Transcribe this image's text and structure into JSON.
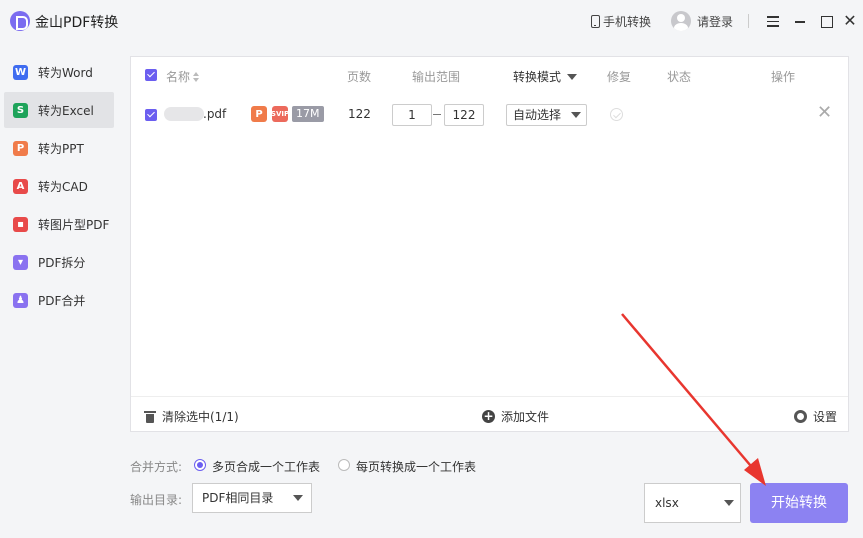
{
  "app": {
    "title": "金山PDF转换"
  },
  "titlebar": {
    "mobile_label": "手机转换",
    "login_label": "请登录"
  },
  "sidebar": {
    "items": [
      {
        "label": "转为Word",
        "icon": "W",
        "color": "#3f6cf0",
        "active": false
      },
      {
        "label": "转为Excel",
        "icon": "S",
        "color": "#1ea35a",
        "active": true
      },
      {
        "label": "转为PPT",
        "icon": "P",
        "color": "#f07b4a",
        "active": false
      },
      {
        "label": "转为CAD",
        "icon": "A",
        "color": "#e84a4a",
        "active": false
      },
      {
        "label": "转图片型PDF",
        "icon": "▪",
        "color": "#e84a4a",
        "active": false
      },
      {
        "label": "PDF拆分",
        "icon": "▾",
        "color": "#8a72f0",
        "active": false
      },
      {
        "label": "PDF合并",
        "icon": "♟",
        "color": "#8a72f0",
        "active": false
      }
    ]
  },
  "table": {
    "headers": {
      "name": "名称",
      "pages": "页数",
      "range": "输出范围",
      "mode": "转换模式",
      "repair": "修复",
      "status": "状态",
      "action": "操作"
    },
    "rows": [
      {
        "filename_suffix": ".pdf",
        "badge_p": "P",
        "badge_svip": "SVIP",
        "size": "17M",
        "pages": "122",
        "range_from": "1",
        "range_to": "122",
        "mode": "自动选择"
      }
    ]
  },
  "footer": {
    "clear_label": "清除选中(1/1)",
    "add_label": "添加文件",
    "settings_label": "设置"
  },
  "options": {
    "merge_label": "合并方式:",
    "merge_options": [
      "多页合成一个工作表",
      "每页转换成一个工作表"
    ],
    "merge_selected": 0,
    "output_label": "输出目录:",
    "output_dir": "PDF相同目录",
    "format": "xlsx",
    "start_label": "开始转换"
  },
  "colors": {
    "accent": "#6b5ef0",
    "start_button": "#8c82f2",
    "annotation_arrow": "#e8362f"
  }
}
